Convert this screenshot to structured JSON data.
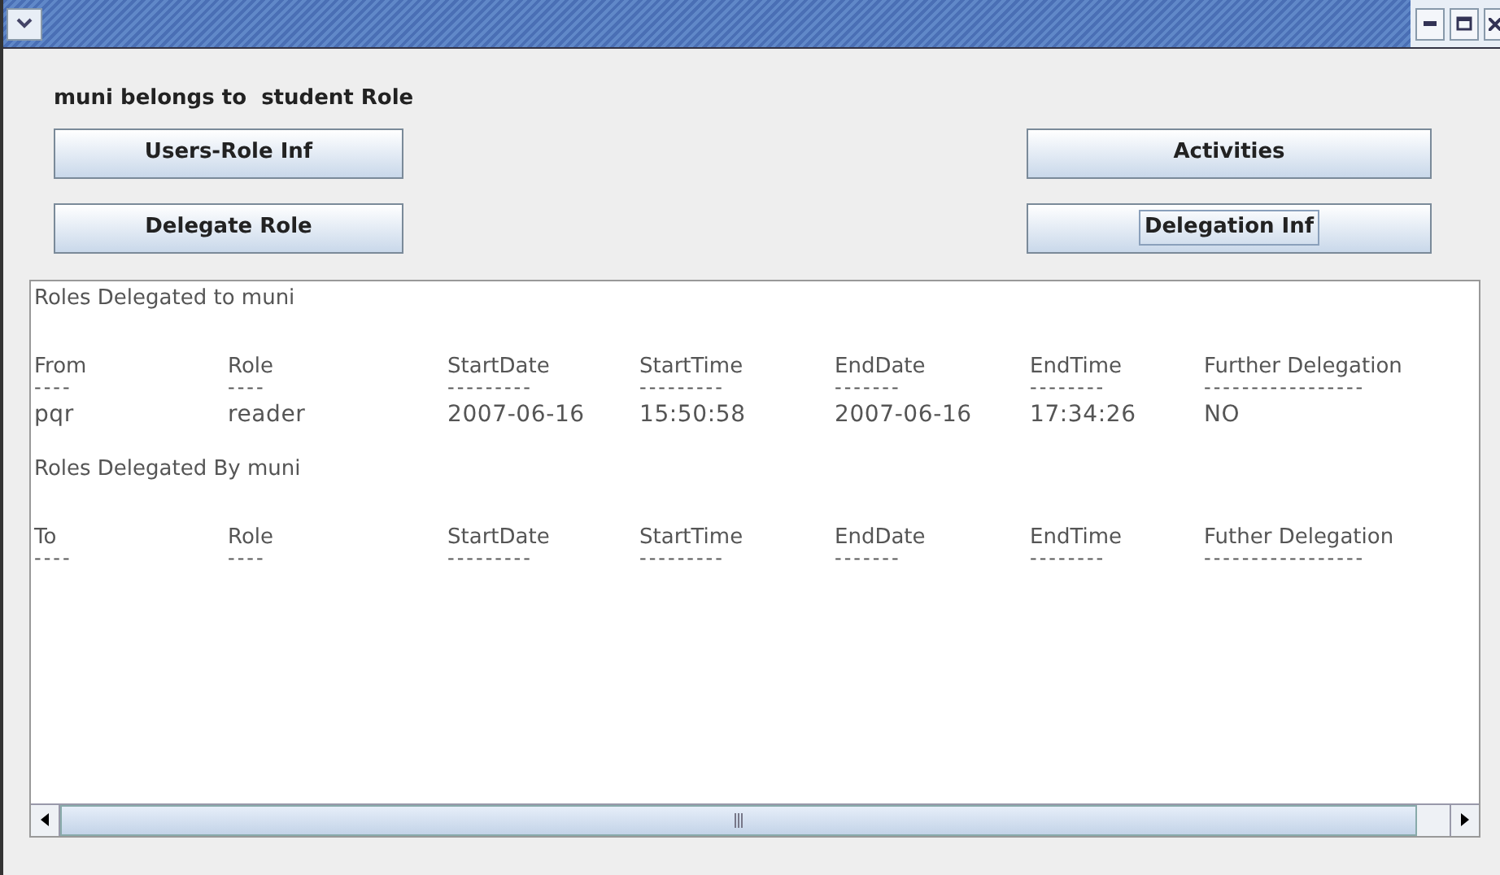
{
  "status_label": "muni belongs to  student Role",
  "buttons": [
    {
      "label": "Users-Role Inf",
      "focused": false
    },
    {
      "label": "Activities",
      "focused": false
    },
    {
      "label": "Delegate Role",
      "focused": false
    },
    {
      "label": "Delegation Inf",
      "focused": true
    }
  ],
  "sections": [
    {
      "title": "Roles Delegated to muni",
      "columns": [
        "From",
        "Role",
        "StartDate",
        "StartTime",
        "EndDate",
        "EndTime",
        "Further Delegation"
      ],
      "underlines": [
        "----",
        "----",
        "---------",
        "---------",
        "-------",
        "--------",
        "-----------------"
      ],
      "rows": [
        [
          "pqr",
          "reader",
          "2007-06-16",
          "15:50:58",
          "2007-06-16",
          "17:34:26",
          "NO"
        ]
      ]
    },
    {
      "title": "Roles Delegated By muni",
      "columns": [
        "To",
        "Role",
        "StartDate",
        "StartTime",
        "EndDate",
        "EndTime",
        "Futher Delegation"
      ],
      "underlines": [
        "----",
        "----",
        "---------",
        "---------",
        "-------",
        "--------",
        "-----------------"
      ]
    }
  ]
}
